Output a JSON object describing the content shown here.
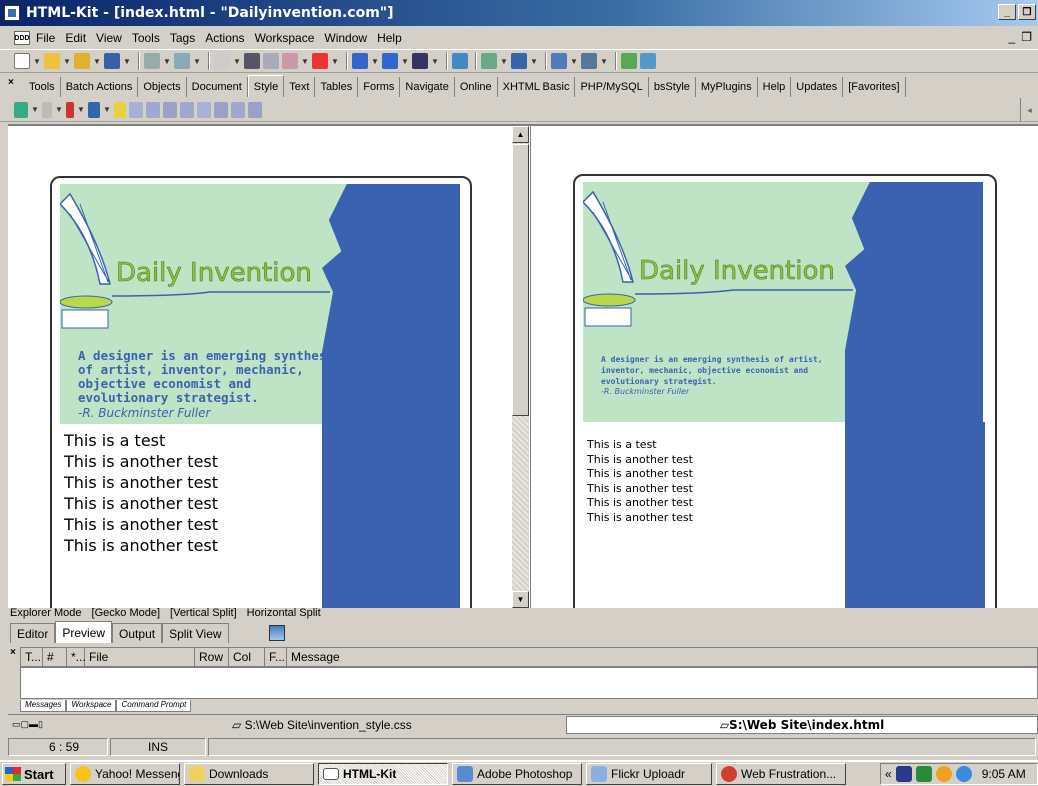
{
  "window": {
    "title": "HTML-Kit - [index.html - \"Dailyinvention.com\"]",
    "controls": {
      "minimize": "_",
      "restore": "❐",
      "close": "×"
    }
  },
  "menu": {
    "items": [
      "File",
      "Edit",
      "View",
      "Tools",
      "Tags",
      "Actions",
      "Workspace",
      "Window",
      "Help"
    ],
    "mdi_controls": {
      "minimize": "_",
      "restore": "❐"
    }
  },
  "plugin_tabs": [
    "Tools",
    "Batch Actions",
    "Objects",
    "Document",
    "Style",
    "Text",
    "Tables",
    "Forms",
    "Navigate",
    "Online",
    "XHTML Basic",
    "PHP/MySQL",
    "bsStyle",
    "MyPlugins",
    "Help",
    "Updates",
    "[Favorites]"
  ],
  "active_plugin_tab": "Style",
  "preview": {
    "headline": "Daily Invention",
    "quote": "A designer is an emerging synthesis of artist, inventor, mechanic, objective economist and evolutionary strategist.",
    "quote_lines_left": [
      "A designer is an emerging synthesis",
      "of artist, inventor, mechanic,",
      "objective economist and",
      "evolutionary strategist."
    ],
    "quote_lines_right": [
      "A designer is an emerging synthesis of artist,",
      "inventor, mechanic, objective economist and",
      "evolutionary strategist."
    ],
    "attribution": "-R. Buckminster Fuller",
    "body_lines": [
      "This is a test",
      "This is another test",
      "This is another test",
      "This is another test",
      "This is another test",
      "This is another test"
    ],
    "colors": {
      "banner": "#bfe3c5",
      "face": "#3b62b0",
      "headline": "#8cc63f"
    }
  },
  "modes": [
    "Explorer Mode",
    "[Gecko Mode]",
    "[Vertical Split]",
    "Horizontal Split"
  ],
  "view_tabs": [
    "Editor",
    "Preview",
    "Output",
    "Split View"
  ],
  "active_view_tab": "Preview",
  "messages": {
    "columns": [
      "T...",
      "#",
      "*...",
      "File",
      "Row",
      "Col",
      "F...",
      "Message"
    ],
    "tabs": [
      "Messages",
      "Workspace",
      "Command Prompt"
    ]
  },
  "files": {
    "left": "S:\\Web Site\\invention_style.css",
    "right": "S:\\Web Site\\index.html"
  },
  "status": {
    "position": "6 : 59",
    "mode": "INS"
  },
  "taskbar": {
    "start": "Start",
    "tasks": [
      "Yahoo! Messeng...",
      "Downloads",
      "HTML-Kit",
      "Adobe Photoshop",
      "Flickr Uploadr",
      "Web Frustration..."
    ],
    "active_task": "HTML-Kit",
    "tray_chevron": "«",
    "clock": "9:05 AM"
  }
}
